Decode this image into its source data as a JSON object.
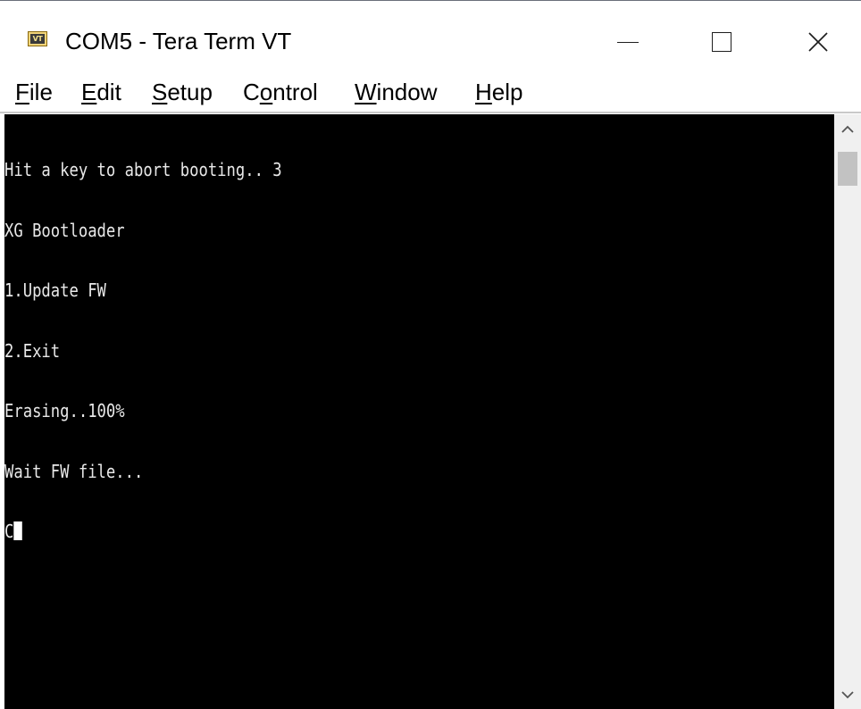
{
  "window": {
    "title": "COM5 - Tera Term VT",
    "icon": "vt-terminal-icon",
    "icon_label": "VT"
  },
  "controls": {
    "minimize": "minimize-icon",
    "maximize": "maximize-icon",
    "close": "close-icon"
  },
  "menu": {
    "file": {
      "accel": "F",
      "rest": "ile"
    },
    "edit": {
      "accel": "E",
      "rest": "dit"
    },
    "setup": {
      "accel": "S",
      "rest": "etup"
    },
    "control": {
      "pre": "C",
      "accel": "o",
      "rest": "ntrol"
    },
    "window": {
      "accel": "W",
      "rest": "indow"
    },
    "help": {
      "accel": "H",
      "rest": "elp"
    }
  },
  "terminal": {
    "lines": [
      "Hit a key to abort booting.. 3",
      "XG Bootloader",
      "1.Update FW",
      "2.Exit",
      "Erasing..100%",
      "Wait FW file...",
      "C"
    ],
    "background": "#000000",
    "foreground": "#e8e8e8"
  },
  "colors": {
    "titlebar_bg": "#ffffff",
    "scrollbar_bg": "#f0f0f0",
    "scroll_thumb": "#c2c2c2"
  }
}
